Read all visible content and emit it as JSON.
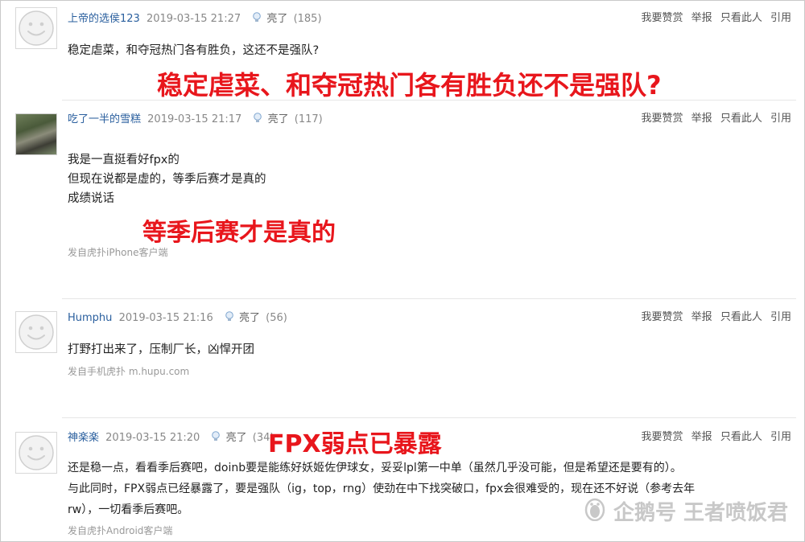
{
  "colors": {
    "username": "#2a5f9e",
    "overlay_red": "#e8161c",
    "meta_gray": "#888888"
  },
  "actions": {
    "appreciate": "我要赞赏",
    "report": "举报",
    "only_this": "只看此人",
    "quote": "引用"
  },
  "light_label": "亮了",
  "replies": [
    {
      "username": "上帝的选侯123",
      "time": "2019-03-15 21:27",
      "light_count": "(185)",
      "avatar": "default-avatar",
      "lines": [
        "稳定虐菜，和夺冠热门各有胜负，这还不是强队?"
      ],
      "source": "",
      "overlay": "稳定虐菜、和夺冠热门各有胜负还不是强队?"
    },
    {
      "username": "吃了一半的雪糕",
      "time": "2019-03-15 21:17",
      "light_count": "(117)",
      "avatar": "photo-avatar",
      "lines": [
        "我是一直挺看好fpx的",
        "但现在说都是虚的，等季后赛才是真的",
        "成绩说话"
      ],
      "source": "发自虎扑iPhone客户端",
      "overlay": "等季后赛才是真的"
    },
    {
      "username": "Humphu",
      "time": "2019-03-15 21:16",
      "light_count": "(56)",
      "avatar": "default-avatar",
      "lines": [
        "打野打出来了，压制厂长，凶悍开团"
      ],
      "source": "发自手机虎扑 m.hupu.com",
      "overlay": ""
    },
    {
      "username": "神楽楽",
      "time": "2019-03-15 21:20",
      "light_count": "(34)",
      "avatar": "default-avatar",
      "lines": [
        "还是稳一点，看看季后赛吧，doinb要是能练好妖姬佐伊球女，妥妥lpl第一中单（虽然几乎没可能，但是希望还是要有的）。",
        "与此同时，FPX弱点已经暴露了，要是强队（ig，top，rng）使劲在中下找突破口，fpx会很难受的，现在还不好说（参考去年",
        "rw），一切看季后赛吧。"
      ],
      "source": "发自虎扑Android客户端",
      "overlay": "FPX弱点已暴露"
    }
  ],
  "watermark": {
    "text": "企鹅号 王者喷饭君",
    "icon": "penguin-icon"
  }
}
